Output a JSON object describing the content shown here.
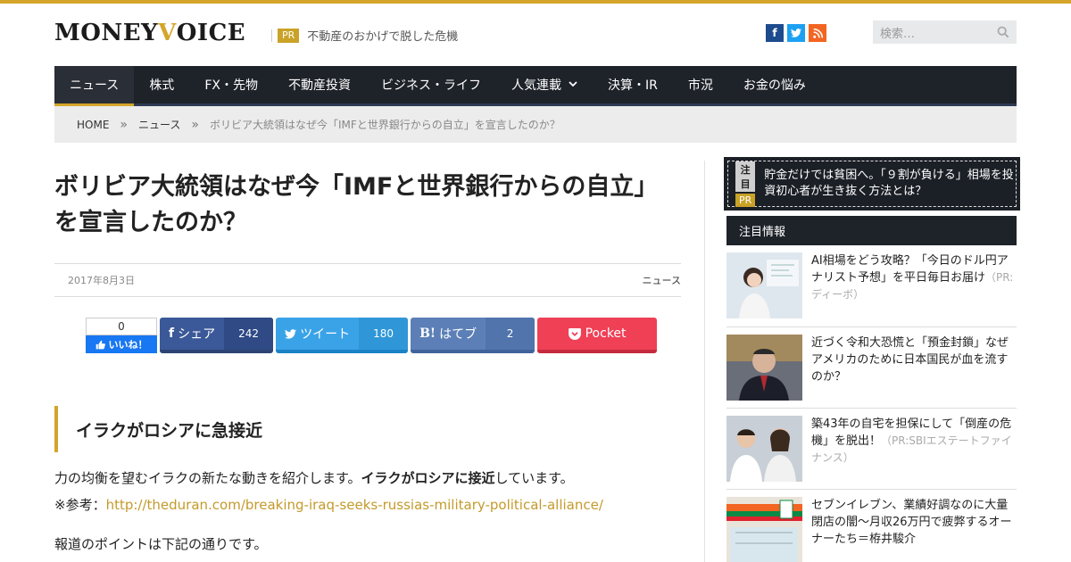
{
  "header": {
    "logo_main": "MONEY ",
    "logo_accent": "V",
    "logo_rest": "OICE",
    "pr_badge": "PR",
    "pr_text": "不動産のおかげで脱した危機",
    "search_placeholder": "検索…",
    "social": [
      "f",
      "t",
      "rss"
    ]
  },
  "nav": {
    "items": [
      {
        "label": "ニュース"
      },
      {
        "label": "株式"
      },
      {
        "label": "FX・先物"
      },
      {
        "label": "不動産投資"
      },
      {
        "label": "ビジネス・ライフ"
      },
      {
        "label": "人気連載"
      },
      {
        "label": "決算・IR"
      },
      {
        "label": "市況"
      },
      {
        "label": "お金の悩み"
      }
    ]
  },
  "breadcrumb": {
    "home": "HOME",
    "sep": "»",
    "category": "ニュース",
    "current": "ボリビア大統領はなぜ今「IMFと世界銀行からの自立」を宣言したのか？"
  },
  "article": {
    "title": "ボリビア大統領はなぜ今「IMFと世界銀行からの自立」を宣言したのか？",
    "date": "2017年8月3日",
    "category": "ニュース",
    "share": {
      "fb_like_count": "0",
      "fb_like_label": "いいね！",
      "facebook_label": "シェア",
      "facebook_count": "242",
      "twitter_label": "ツイート",
      "twitter_count": "180",
      "hatena_label": "はてブ",
      "hatena_count": "2",
      "pocket_label": "Pocket"
    },
    "heading": "イラクがロシアに急接近",
    "p1_before": "力の均衡を望むイラクの新たな動きを紹介します。",
    "p1_bold": "イラクがロシアに接近",
    "p1_after": "しています。",
    "p2_label": "※参考：",
    "p2_link": "http://theduran.com/breaking-iraq-seeks-russias-military-political-alliance/",
    "p3": "報道のポイントは下記の通りです。"
  },
  "sidebar": {
    "attention": {
      "tag1": "注目",
      "tag2": "PR",
      "text": "貯金だけでは貧困へ。「９割が負ける」相場を投資初心者が生き抜く方法とは？"
    },
    "section_title": "注目情報",
    "items": [
      {
        "title": "AI相場をどう攻略？「今日のドル円アナリスト予想」を平日毎日お届け",
        "pr": "（PR:ディーボ）"
      },
      {
        "title": "近づく令和大恐慌と「預金封鎖」なぜアメリカのために日本国民が血を流すのか？",
        "pr": ""
      },
      {
        "title": "築43年の自宅を担保にして「倒産の危機」を脱出！",
        "pr": "（PR:SBIエステートファイナンス）"
      },
      {
        "title": "セブンイレブン、業績好調なのに大量閉店の闇～月収26万円で疲弊するオーナーたち＝栫井駿介",
        "pr": ""
      }
    ]
  }
}
